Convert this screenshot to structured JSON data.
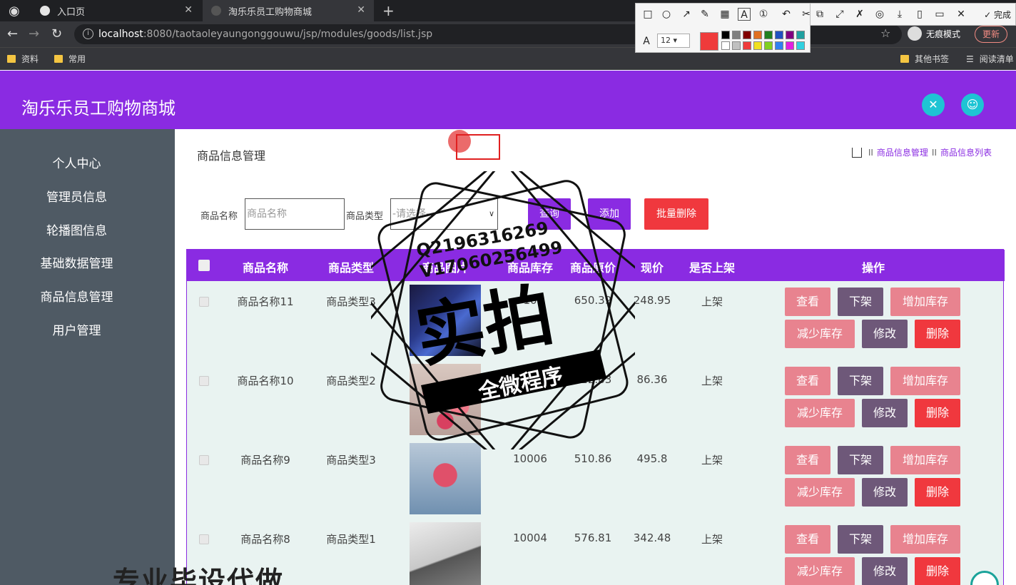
{
  "browser": {
    "tabs": [
      {
        "label": "入口页",
        "active": false
      },
      {
        "label": "淘乐乐员工购物商城",
        "active": true
      }
    ],
    "url_host": "localhost",
    "url_rest": ":8080/taotaoleyaungonggouwu/jsp/modules/goods/list.jsp",
    "incognito_label": "无痕模式",
    "update_label": "更新",
    "bookmarks": [
      "资料",
      "常用"
    ],
    "bookmarks_right": [
      "其他书签",
      "阅读清单"
    ]
  },
  "annotation_toolbar": {
    "font_size": "12",
    "finish_label": "完成",
    "current_color": "#ef3b3b",
    "palette": [
      "#000000",
      "#808080",
      "#800000",
      "#e07020",
      "#208020",
      "#2050c0",
      "#800080",
      "#20a0a0",
      "#ffffff",
      "#c0c0c0",
      "#ef3b3b",
      "#f0e020",
      "#80d020",
      "#3080f0",
      "#e020e0",
      "#30d0e0"
    ]
  },
  "app": {
    "title": "淘乐乐员工购物商城",
    "accent": "#8a2be2"
  },
  "sidebar": {
    "items": [
      "个人中心",
      "管理员信息",
      "轮播图信息",
      "基础数据管理",
      "商品信息管理",
      "用户管理"
    ]
  },
  "page": {
    "title": "商品信息管理",
    "breadcrumb": [
      "商品信息管理",
      "商品信息列表"
    ]
  },
  "search": {
    "name_label": "商品名称",
    "name_placeholder": "商品名称",
    "type_label": "商品类型",
    "type_selected": "-请选择-",
    "query_label": "查询",
    "add_label": "添加",
    "batch_delete_label": "批量删除"
  },
  "table": {
    "headers": [
      "商品名称",
      "商品类型",
      "商品图片",
      "商品库存",
      "商品原价",
      "现价",
      "是否上架",
      "操作"
    ],
    "rows": [
      {
        "name": "商品名称11",
        "type": "商品类型3",
        "stock": "10",
        "price": "650.39",
        "current": "248.95",
        "status": "上架",
        "image": "phone"
      },
      {
        "name": "商品名称10",
        "type": "商品类型2",
        "stock": "",
        "price": "622.83",
        "current": "86.36",
        "status": "上架",
        "image": "flowers"
      },
      {
        "name": "商品名称9",
        "type": "商品类型3",
        "stock": "10006",
        "price": "510.86",
        "current": "495.8",
        "status": "上架",
        "image": "bouquet"
      },
      {
        "name": "商品名称8",
        "type": "商品类型1",
        "stock": "10004",
        "price": "576.81",
        "current": "342.48",
        "status": "上架",
        "image": "laptop"
      }
    ],
    "actions": {
      "view": "查看",
      "unlist": "下架",
      "add_stock": "增加库存",
      "reduce_stock": "减少库存",
      "edit": "修改",
      "delete": "删除"
    }
  },
  "watermark": {
    "line1": "Q2196316269",
    "line2": "V17060256499",
    "big": "实拍",
    "banner": "全微程序",
    "bottom": "专业毕设代做"
  }
}
